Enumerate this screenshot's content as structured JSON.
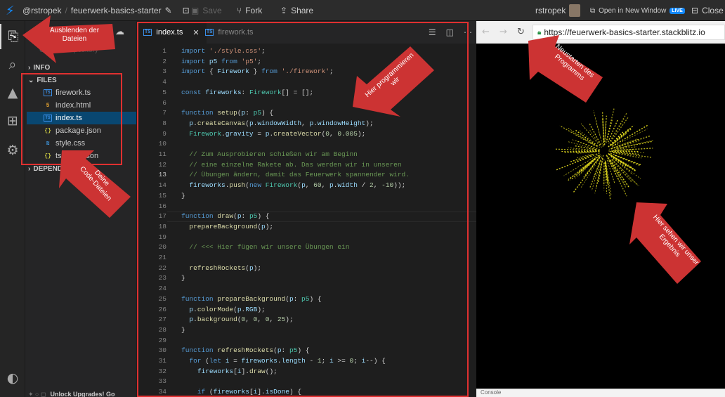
{
  "topbar": {
    "user": "@rstropek",
    "separator": "/",
    "project": "feuerwerk-basics-starter",
    "save_label": "Save",
    "fork_label": "Fork",
    "share_label": "Share",
    "account_name": "rstropek",
    "open_new_window_label": "Open in New Window",
    "live_badge": "LIVE",
    "close_label": "Close"
  },
  "sidebar": {
    "project_label": "PRO",
    "connect_repo": "Connect repository",
    "info_label": "INFO",
    "files_label": "FILES",
    "dependencies_label": "DEPENDEN",
    "files": [
      {
        "name": "firework.ts",
        "icon": "ts-file-icon"
      },
      {
        "name": "index.html",
        "icon": "html-file-icon"
      },
      {
        "name": "index.ts",
        "icon": "ts-file-icon",
        "selected": true
      },
      {
        "name": "package.json",
        "icon": "json-file-icon"
      },
      {
        "name": "style.css",
        "icon": "css-file-icon"
      },
      {
        "name": "tsconfig.json",
        "icon": "json-file-icon"
      }
    ],
    "footer_text": "Unlock Upgrades! Go"
  },
  "editor": {
    "tabs": [
      {
        "label": "index.ts",
        "active": true
      },
      {
        "label": "firework.ts",
        "active": false
      }
    ],
    "current_line": 13,
    "code_lines": [
      [
        [
          "k",
          "import "
        ],
        [
          "s",
          "'./style.css'"
        ],
        [
          "p",
          ";"
        ]
      ],
      [
        [
          "k",
          "import "
        ],
        [
          "v",
          "p5"
        ],
        [
          "k",
          " from "
        ],
        [
          "s",
          "'p5'"
        ],
        [
          "p",
          ";"
        ]
      ],
      [
        [
          "k",
          "import "
        ],
        [
          "p",
          "{ "
        ],
        [
          "v",
          "Firework"
        ],
        [
          "p",
          " } "
        ],
        [
          "k",
          "from "
        ],
        [
          "s",
          "'./firework'"
        ],
        [
          "p",
          ";"
        ]
      ],
      [],
      [
        [
          "k",
          "const "
        ],
        [
          "v",
          "fireworks"
        ],
        [
          "p",
          ": "
        ],
        [
          "t",
          "Firework"
        ],
        [
          "p",
          "[] = [];"
        ]
      ],
      [],
      [
        [
          "k",
          "function "
        ],
        [
          "f",
          "setup"
        ],
        [
          "p",
          "("
        ],
        [
          "v",
          "p"
        ],
        [
          "p",
          ": "
        ],
        [
          "t",
          "p5"
        ],
        [
          "p",
          ") {"
        ]
      ],
      [
        [
          "p",
          "  "
        ],
        [
          "v",
          "p"
        ],
        [
          "p",
          "."
        ],
        [
          "f",
          "createCanvas"
        ],
        [
          "p",
          "("
        ],
        [
          "v",
          "p"
        ],
        [
          "p",
          "."
        ],
        [
          "v",
          "windowWidth"
        ],
        [
          "p",
          ", "
        ],
        [
          "v",
          "p"
        ],
        [
          "p",
          "."
        ],
        [
          "v",
          "windowHeight"
        ],
        [
          "p",
          ");"
        ]
      ],
      [
        [
          "p",
          "  "
        ],
        [
          "t",
          "Firework"
        ],
        [
          "p",
          "."
        ],
        [
          "v",
          "gravity"
        ],
        [
          "p",
          " = "
        ],
        [
          "v",
          "p"
        ],
        [
          "p",
          "."
        ],
        [
          "f",
          "createVector"
        ],
        [
          "p",
          "("
        ],
        [
          "n",
          "0"
        ],
        [
          "p",
          ", "
        ],
        [
          "n",
          "0.005"
        ],
        [
          "p",
          ");"
        ]
      ],
      [],
      [
        [
          "c",
          "  // Zum Ausprobieren schießen wir am Beginn"
        ]
      ],
      [
        [
          "c",
          "  // eine einzelne Rakete ab. Das werden wir in unseren"
        ]
      ],
      [
        [
          "c",
          "  // Übungen ändern, damit das Feuerwerk spannender wird."
        ]
      ],
      [
        [
          "p",
          "  "
        ],
        [
          "v",
          "fireworks"
        ],
        [
          "p",
          "."
        ],
        [
          "f",
          "push"
        ],
        [
          "p",
          "("
        ],
        [
          "k",
          "new "
        ],
        [
          "t",
          "Firework"
        ],
        [
          "p",
          "("
        ],
        [
          "v",
          "p"
        ],
        [
          "p",
          ", "
        ],
        [
          "n",
          "60"
        ],
        [
          "p",
          ", "
        ],
        [
          "v",
          "p"
        ],
        [
          "p",
          "."
        ],
        [
          "v",
          "width"
        ],
        [
          "p",
          " / "
        ],
        [
          "n",
          "2"
        ],
        [
          "p",
          ", "
        ],
        [
          "n",
          "-10"
        ],
        [
          "p",
          "));"
        ]
      ],
      [
        [
          "p",
          "}"
        ]
      ],
      [],
      [
        [
          "k",
          "function "
        ],
        [
          "f",
          "draw"
        ],
        [
          "p",
          "("
        ],
        [
          "v",
          "p"
        ],
        [
          "p",
          ": "
        ],
        [
          "t",
          "p5"
        ],
        [
          "p",
          ") {"
        ]
      ],
      [
        [
          "p",
          "  "
        ],
        [
          "f",
          "prepareBackground"
        ],
        [
          "p",
          "("
        ],
        [
          "v",
          "p"
        ],
        [
          "p",
          ");"
        ]
      ],
      [],
      [
        [
          "c",
          "  // <<< Hier fügen wir unsere Übungen ein"
        ]
      ],
      [],
      [
        [
          "p",
          "  "
        ],
        [
          "f",
          "refreshRockets"
        ],
        [
          "p",
          "("
        ],
        [
          "v",
          "p"
        ],
        [
          "p",
          ");"
        ]
      ],
      [
        [
          "p",
          "}"
        ]
      ],
      [],
      [
        [
          "k",
          "function "
        ],
        [
          "f",
          "prepareBackground"
        ],
        [
          "p",
          "("
        ],
        [
          "v",
          "p"
        ],
        [
          "p",
          ": "
        ],
        [
          "t",
          "p5"
        ],
        [
          "p",
          ") {"
        ]
      ],
      [
        [
          "p",
          "  "
        ],
        [
          "v",
          "p"
        ],
        [
          "p",
          "."
        ],
        [
          "f",
          "colorMode"
        ],
        [
          "p",
          "("
        ],
        [
          "v",
          "p"
        ],
        [
          "p",
          "."
        ],
        [
          "v",
          "RGB"
        ],
        [
          "p",
          ");"
        ]
      ],
      [
        [
          "p",
          "  "
        ],
        [
          "v",
          "p"
        ],
        [
          "p",
          "."
        ],
        [
          "f",
          "background"
        ],
        [
          "p",
          "("
        ],
        [
          "n",
          "0"
        ],
        [
          "p",
          ", "
        ],
        [
          "n",
          "0"
        ],
        [
          "p",
          ", "
        ],
        [
          "n",
          "0"
        ],
        [
          "p",
          ", "
        ],
        [
          "n",
          "25"
        ],
        [
          "p",
          ");"
        ]
      ],
      [
        [
          "p",
          "}"
        ]
      ],
      [],
      [
        [
          "k",
          "function "
        ],
        [
          "f",
          "refreshRockets"
        ],
        [
          "p",
          "("
        ],
        [
          "v",
          "p"
        ],
        [
          "p",
          ": "
        ],
        [
          "t",
          "p5"
        ],
        [
          "p",
          ") {"
        ]
      ],
      [
        [
          "p",
          "  "
        ],
        [
          "k",
          "for "
        ],
        [
          "p",
          "("
        ],
        [
          "k",
          "let "
        ],
        [
          "v",
          "i"
        ],
        [
          "p",
          " = "
        ],
        [
          "v",
          "fireworks"
        ],
        [
          "p",
          "."
        ],
        [
          "v",
          "length"
        ],
        [
          "p",
          " - "
        ],
        [
          "n",
          "1"
        ],
        [
          "p",
          "; "
        ],
        [
          "v",
          "i"
        ],
        [
          "p",
          " >= "
        ],
        [
          "n",
          "0"
        ],
        [
          "p",
          "; "
        ],
        [
          "v",
          "i"
        ],
        [
          "p",
          "--) {"
        ]
      ],
      [
        [
          "p",
          "    "
        ],
        [
          "v",
          "fireworks"
        ],
        [
          "p",
          "["
        ],
        [
          "v",
          "i"
        ],
        [
          "p",
          "]."
        ],
        [
          "f",
          "draw"
        ],
        [
          "p",
          "();"
        ]
      ],
      [],
      [
        [
          "p",
          "    "
        ],
        [
          "k",
          "if "
        ],
        [
          "p",
          "("
        ],
        [
          "v",
          "fireworks"
        ],
        [
          "p",
          "["
        ],
        [
          "v",
          "i"
        ],
        [
          "p",
          "]."
        ],
        [
          "v",
          "isDone"
        ],
        [
          "p",
          ") {"
        ]
      ]
    ]
  },
  "preview": {
    "url": "https://feuerwerk-basics-starter.stackblitz.io",
    "console_label": "Console",
    "firework_color": "#e8e020"
  },
  "annotations": {
    "hide_files": "Ausblenden der\nDateien",
    "code_files": "Deine\nCode-Dateien",
    "we_program_here": "Hier programmieren\nwir",
    "restart_program": "Neustarten des\nProgramms",
    "see_result": "Hier sehen wir unser\nErgebnis",
    "arrow_color": "#cc3333"
  }
}
